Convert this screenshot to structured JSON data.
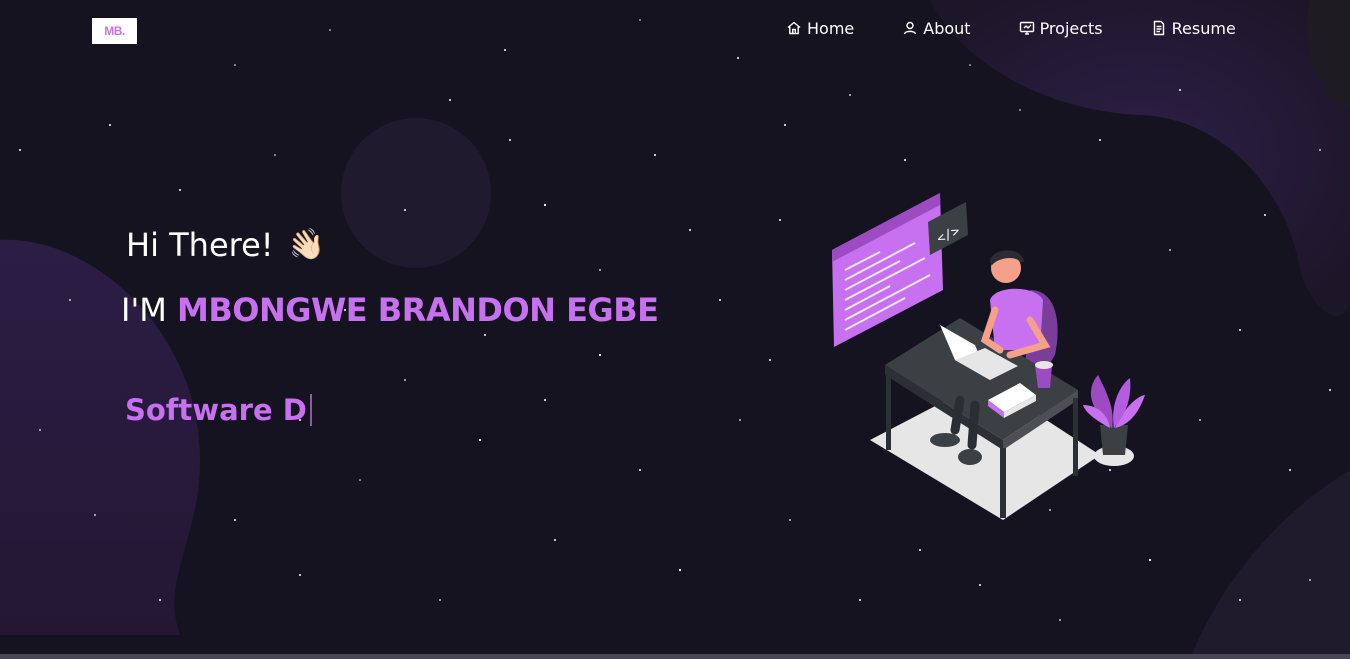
{
  "logo": {
    "text": "MB."
  },
  "nav": {
    "items": [
      {
        "label": "Home",
        "icon": "home-icon"
      },
      {
        "label": "About",
        "icon": "user-icon"
      },
      {
        "label": "Projects",
        "icon": "projects-icon"
      },
      {
        "label": "Resume",
        "icon": "document-icon"
      }
    ]
  },
  "hero": {
    "greeting": "Hi There!",
    "wave_emoji": "👋🏻",
    "name_prefix": "I'M",
    "name": "MBONGWE BRANDON EGBE",
    "typewriter_text": "Software D"
  },
  "colors": {
    "accent": "#c770f0",
    "background": "#161320",
    "blob": "#2a1d40"
  }
}
